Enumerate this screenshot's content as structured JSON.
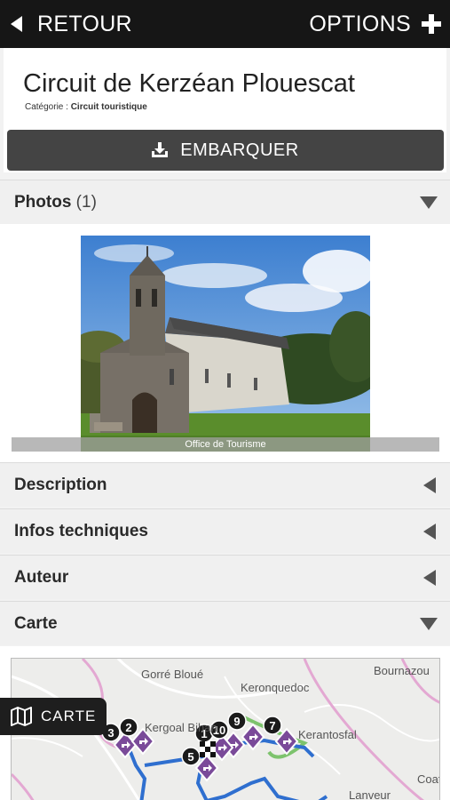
{
  "topbar": {
    "back_label": "RETOUR",
    "options_label": "OPTIONS"
  },
  "header": {
    "title": "Circuit de Kerzéan Plouescat",
    "category_prefix": "Catégorie : ",
    "category_value": "Circuit touristique",
    "embark_label": "EMBARQUER"
  },
  "sections": {
    "photos": {
      "label": "Photos",
      "count": "(1)"
    },
    "description": {
      "label": "Description"
    },
    "infos": {
      "label": "Infos techniques"
    },
    "auteur": {
      "label": "Auteur"
    },
    "carte": {
      "label": "Carte"
    }
  },
  "photo": {
    "caption": "Office de Tourisme"
  },
  "map": {
    "places": [
      "Gorré Bloué",
      "Keronquedoc",
      "Bournazou",
      "Kergoal Bihan",
      "Kerantosfal",
      "Lanveur",
      "Coat"
    ],
    "markers": [
      "1",
      "2",
      "3",
      "5",
      "7",
      "9",
      "10"
    ]
  },
  "carte_button": {
    "label": "CARTE"
  },
  "colors": {
    "route": "#2f6fcf",
    "marker": "#7a4a99",
    "topbar": "#161616"
  }
}
